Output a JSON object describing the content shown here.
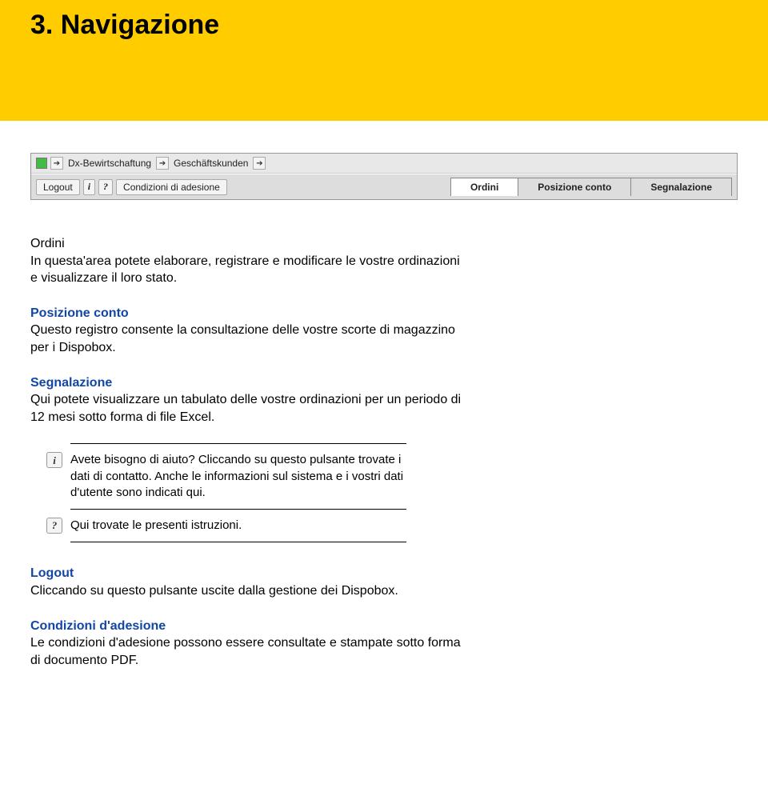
{
  "title": "3.   Navigazione",
  "nav": {
    "breadcrumbs": [
      "Dx-Bewirtschaftung",
      "Geschäftskunden"
    ],
    "toolbar": {
      "logout": "Logout",
      "info": "i",
      "help": "?",
      "conditions": "Condizioni di adesione"
    },
    "tabs": [
      "Ordini",
      "Posizione conto",
      "Segnalazione"
    ]
  },
  "sections": {
    "ordini": {
      "heading": "Ordini",
      "body": "In questa'area potete elaborare, registrare e modificare le vostre ordinazioni  e visualizzare il loro stato."
    },
    "posizione": {
      "heading": "Posizione conto",
      "body": "Questo registro consente la consultazione delle vostre scorte di magazzino per i Dispobox."
    },
    "segnalazione": {
      "heading": "Segnalazione",
      "body": "Qui potete visualizzare un tabulato delle vostre ordinazioni per un periodo di 12 mesi sotto forma di file Excel."
    },
    "notes": {
      "info": "Avete bisogno di aiuto? Cliccando su questo pulsante trovate i dati di contatto. Anche le informazioni sul sistema e i vostri dati d'utente sono indicati qui.",
      "help": "Qui trovate le presenti istruzioni."
    },
    "logout": {
      "heading": "Logout",
      "body": "Cliccando su questo pulsante uscite dalla gestione dei Dispobox."
    },
    "condizioni": {
      "heading": "Condizioni d'adesione",
      "body": "Le condizioni d'adesione possono essere consultate e stampate sotto forma di documento PDF."
    }
  }
}
